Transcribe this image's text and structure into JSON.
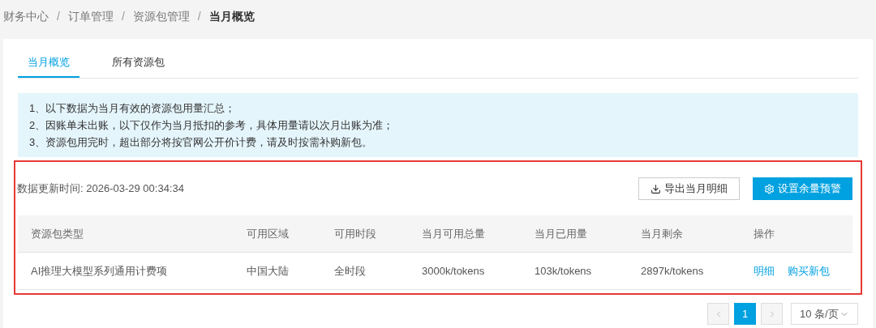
{
  "breadcrumb": [
    {
      "label": "财务中心",
      "current": false
    },
    {
      "label": "订单管理",
      "current": false
    },
    {
      "label": "资源包管理",
      "current": false
    },
    {
      "label": "当月概览",
      "current": true
    }
  ],
  "breadcrumb_separator": "/",
  "tabs": [
    {
      "label": "当月概览",
      "selected": true
    },
    {
      "label": "所有资源包",
      "selected": false
    }
  ],
  "notice": [
    "1、以下数据为当月有效的资源包用量汇总；",
    "2、因账单未出账，以下仅作为当月抵扣的参考，具体用量请以次月出账为准；",
    "3、资源包用完时，超出部分将按官网公开价计费，请及时按需补购新包。"
  ],
  "highlighted": true,
  "update_time": "数据更新时间: 2026-03-29 00:34:34",
  "buttons": [
    {
      "label": "导出当月明细",
      "kind": "export"
    },
    {
      "label": "设置余量预警",
      "kind": "settings"
    }
  ],
  "table": {
    "columns": [
      "资源包类型",
      "可用区域",
      "可用时段",
      "当月可用总量",
      "当月已用量",
      "当月剩余",
      "操作"
    ],
    "rows": [
      {
        "cells": [
          "AI推理大模型系列通用计费项",
          "中国大陆",
          "全时段",
          "3000k/tokens",
          "103k/tokens",
          "2897k/tokens"
        ],
        "actions": [
          "明细",
          "购买新包"
        ]
      }
    ]
  },
  "pagination": {
    "pages": [
      {
        "label": "1",
        "selected": true
      }
    ],
    "page_size": "10 条/页"
  }
}
